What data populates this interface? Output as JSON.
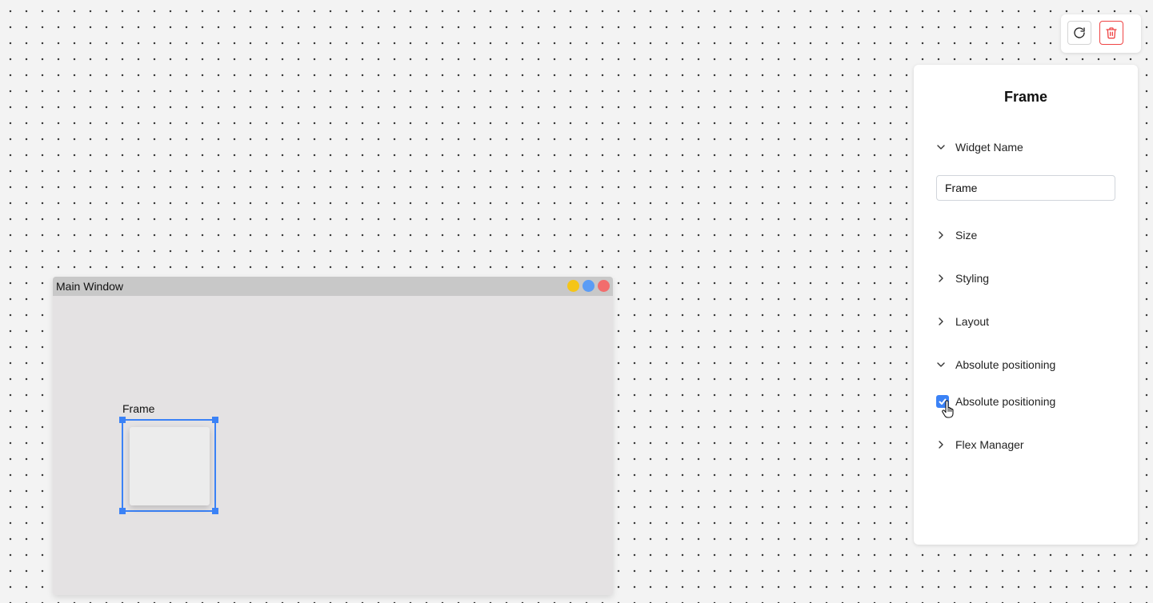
{
  "toolbar": {
    "reload_icon": "reload-icon",
    "delete_icon": "trash-icon",
    "delete_color": "#ef4444"
  },
  "main_window": {
    "title": "Main Window",
    "buttons": {
      "minimize_color": "#f5c518",
      "maximize_color": "#5b9cf5",
      "close_color": "#f26d6d"
    },
    "frame": {
      "label": "Frame",
      "selection_color": "#3b82f6"
    }
  },
  "panel": {
    "title": "Frame",
    "sections": [
      {
        "label": "Widget Name",
        "expanded": true
      },
      {
        "label": "Size",
        "expanded": false
      },
      {
        "label": "Styling",
        "expanded": false
      },
      {
        "label": "Layout",
        "expanded": false
      },
      {
        "label": "Absolute positioning",
        "expanded": true
      },
      {
        "label": "Flex Manager",
        "expanded": false
      }
    ],
    "widget_name_value": "Frame",
    "absolute_positioning": {
      "label": "Absolute positioning",
      "checked": true
    }
  }
}
